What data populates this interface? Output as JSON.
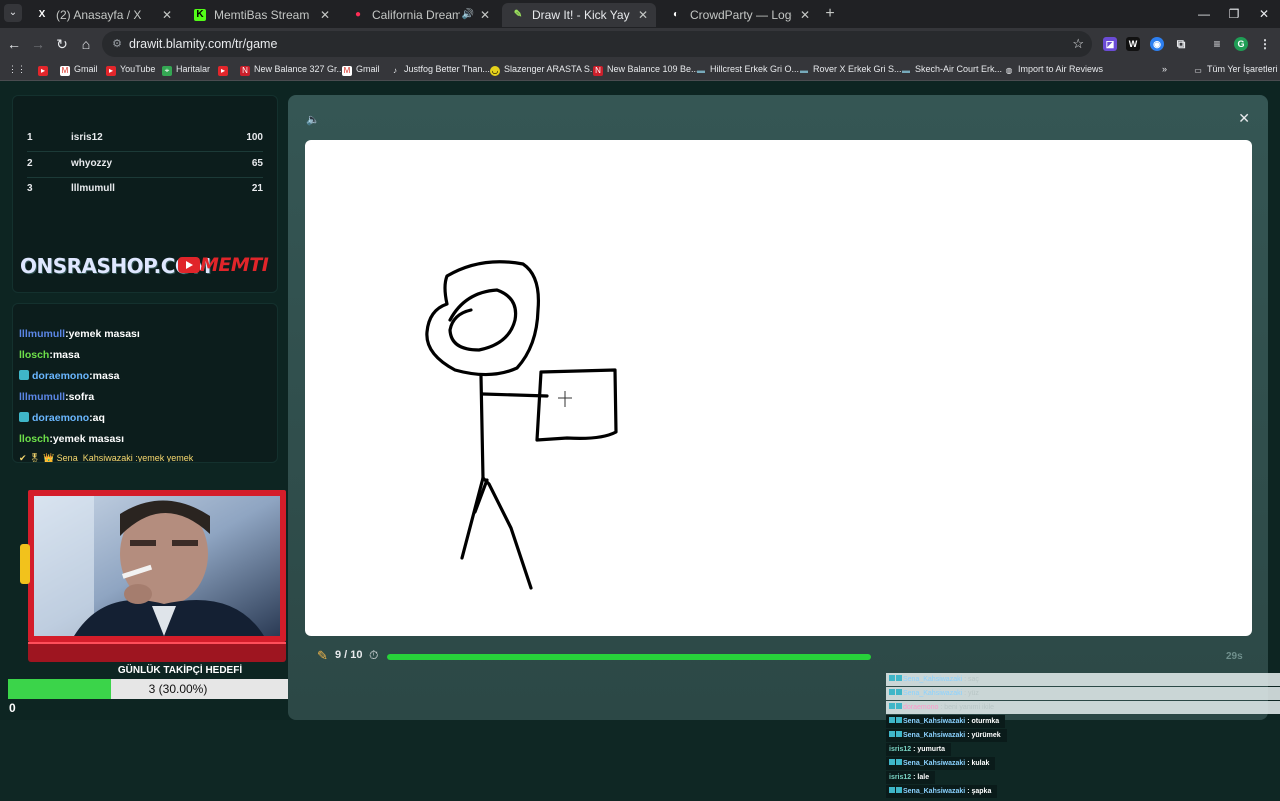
{
  "browser": {
    "tabs": [
      {
        "title": "(2) Anasayfa / X",
        "favicon": "X",
        "active": false
      },
      {
        "title": "MemtiBas Stream - Watch Live",
        "favicon": "K",
        "active": false
      },
      {
        "title": "California Dreamin' - YouTube",
        "favicon": "●",
        "active": false
      },
      {
        "title": "Draw It! - Kick Yayınları İçin Çizim",
        "favicon": "✎",
        "active": true
      },
      {
        "title": "CrowdParty — Logoyu Tahmin Et",
        "favicon": "◐",
        "active": false
      }
    ],
    "url": "drawit.blamity.com/tr/game",
    "bookmarks": [
      {
        "label": "",
        "icon": "youtube"
      },
      {
        "label": "Gmail",
        "icon": "gmail"
      },
      {
        "label": "YouTube",
        "icon": "youtube"
      },
      {
        "label": "Haritalar",
        "icon": "maps"
      },
      {
        "label": "",
        "icon": "youtube"
      },
      {
        "label": "New Balance 327 Gr...",
        "icon": "nb"
      },
      {
        "label": "Gmail",
        "icon": "gmail"
      },
      {
        "label": "Justfog Better Than...",
        "icon": "generic"
      },
      {
        "label": "Slazenger ARASTA S...",
        "icon": "slz"
      },
      {
        "label": "New Balance 109 Be...",
        "icon": "nb"
      },
      {
        "label": "Hillcrest Erkek Gri O...",
        "icon": "generic"
      },
      {
        "label": "Rover X Erkek Gri S...",
        "icon": "generic"
      },
      {
        "label": "Skech-Air Court Erk...",
        "icon": "generic"
      },
      {
        "label": "Import to Air Reviews",
        "icon": "globe"
      }
    ],
    "all_bookmarks": "Tüm Yer İşaretleri"
  },
  "leaderboard": [
    {
      "rank": "1",
      "name": "isris12",
      "score": "100"
    },
    {
      "rank": "2",
      "name": "whyozzy",
      "score": "65"
    },
    {
      "rank": "3",
      "name": "lllmumull",
      "score": "21"
    }
  ],
  "sponsor": {
    "shop": "ONSRASHOP.COM",
    "channel": "MEMTI"
  },
  "chat": [
    {
      "user": "lllmumull",
      "message": ":yemek masası",
      "color": "blue",
      "badge": false
    },
    {
      "user": "llosch",
      "message": ":masa",
      "color": "green",
      "badge": false
    },
    {
      "user": "doraemono",
      "message": ":masa",
      "color": "cyan",
      "badge": true
    },
    {
      "user": "lllmumull",
      "message": ":sofra",
      "color": "blue",
      "badge": false
    },
    {
      "user": "doraemono",
      "message": ":aq",
      "color": "cyan",
      "badge": true
    },
    {
      "user": "llosch",
      "message": ":yemek masası",
      "color": "green",
      "badge": false
    }
  ],
  "chat_partial": "✔ 🎖 👑 Sena_Kahsiwazaki :yemek yemek",
  "follower_goal": {
    "label": "GÜNLÜK TAKİPÇİ HEDEFİ",
    "text": "3 (30.00%)",
    "progress": 0.3,
    "min": "0",
    "max": "10"
  },
  "game": {
    "round": "9 / 10",
    "time_progress": 1.0,
    "timer": "29s"
  },
  "overlay_chat": [
    {
      "user": "Sena_Kahsiwazaki",
      "message": ": saç",
      "style": "dim"
    },
    {
      "user": "Sena_Kahsiwazaki",
      "message": ": yüz",
      "style": "dim"
    },
    {
      "user": "doraemono",
      "message": ": beni yanımi ikile",
      "style": "dim"
    },
    {
      "user": "Sena_Kahsiwazaki",
      "message": ": oturmka",
      "style": "dark"
    },
    {
      "user": "Sena_Kahsiwazaki",
      "message": ": yürümek",
      "style": "dark"
    },
    {
      "user": "isris12",
      "message": ": yumurta",
      "style": "dark"
    },
    {
      "user": "Sena_Kahsiwazaki",
      "message": ": kulak",
      "style": "dark"
    },
    {
      "user": "isris12",
      "message": ": lale",
      "style": "dark"
    },
    {
      "user": "Sena_Kahsiwazaki",
      "message": ": şapka",
      "style": "dark"
    }
  ]
}
